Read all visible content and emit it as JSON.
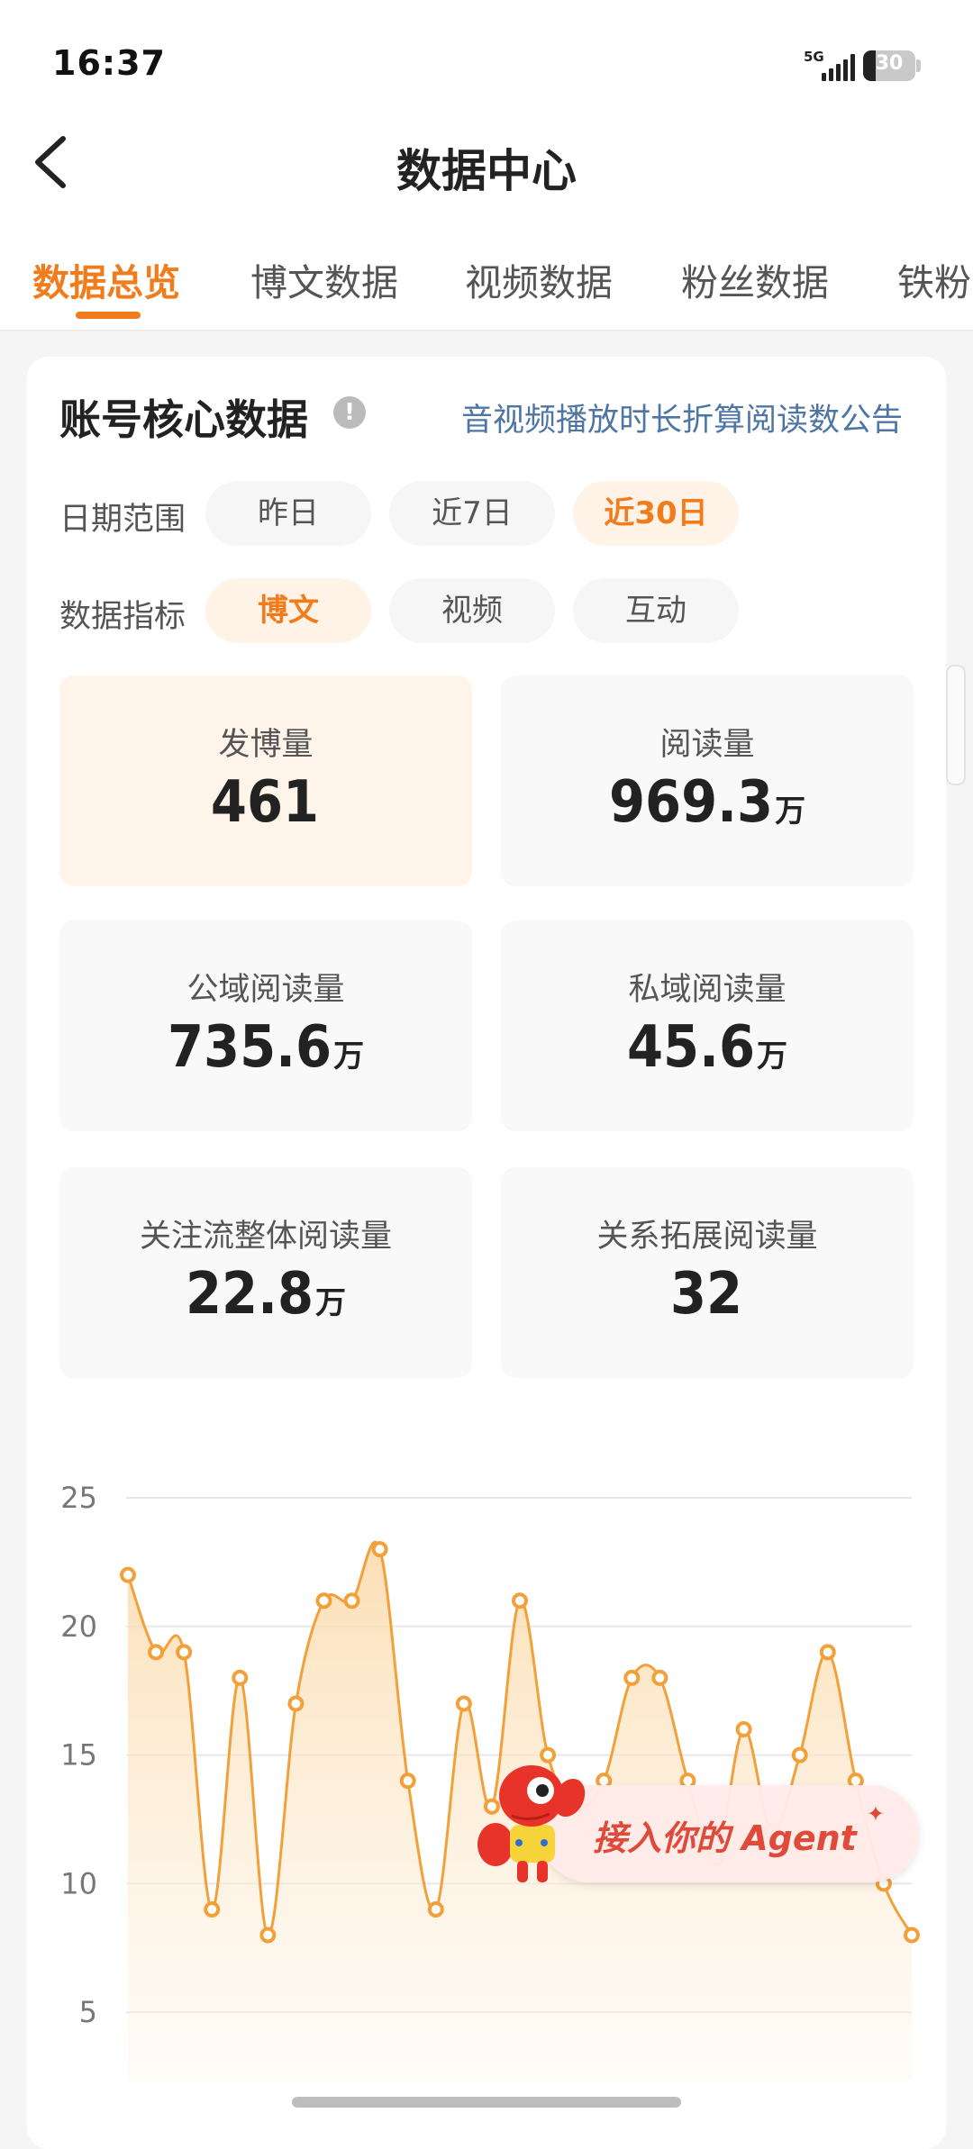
{
  "status_bar": {
    "time": "16:37",
    "network": "5G",
    "battery": "30"
  },
  "header": {
    "title": "数据中心"
  },
  "tabs": [
    {
      "label": "数据总览",
      "active": true
    },
    {
      "label": "博文数据",
      "active": false
    },
    {
      "label": "视频数据",
      "active": false
    },
    {
      "label": "粉丝数据",
      "active": false
    },
    {
      "label": "铁粉",
      "active": false
    }
  ],
  "section": {
    "title": "账号核心数据",
    "notice": "音视频播放时长折算阅读数公告"
  },
  "filters": {
    "date_label": "日期范围",
    "date_options": [
      "昨日",
      "近7日",
      "近30日"
    ],
    "date_selected": "近30日",
    "metric_label": "数据指标",
    "metric_options": [
      "博文",
      "视频",
      "互动"
    ],
    "metric_selected": "博文"
  },
  "stats": [
    {
      "label": "发博量",
      "value": "461",
      "unit": ""
    },
    {
      "label": "阅读量",
      "value": "969.3",
      "unit": "万"
    },
    {
      "label": "公域阅读量",
      "value": "735.6",
      "unit": "万"
    },
    {
      "label": "私域阅读量",
      "value": "45.6",
      "unit": "万"
    },
    {
      "label": "关注流整体阅读量",
      "value": "22.8",
      "unit": "万"
    },
    {
      "label": "关系拓展阅读量",
      "value": "32",
      "unit": ""
    }
  ],
  "chart_data": {
    "type": "area",
    "title": "",
    "xlabel": "",
    "ylabel": "",
    "y_ticks": [
      5,
      10,
      15,
      20,
      25
    ],
    "ylim": [
      0,
      25
    ],
    "grid": true,
    "color": "#f2a03a",
    "series": [
      {
        "values": [
          22,
          19,
          19,
          9,
          18,
          8,
          17,
          21,
          21,
          23,
          14,
          9,
          17,
          13,
          21,
          15,
          13,
          14,
          18,
          18,
          14,
          11,
          16,
          12,
          15,
          19,
          14,
          10,
          8
        ]
      }
    ]
  },
  "agent_banner": {
    "text": "接入你的 Agent",
    "sparkle": "✦"
  }
}
